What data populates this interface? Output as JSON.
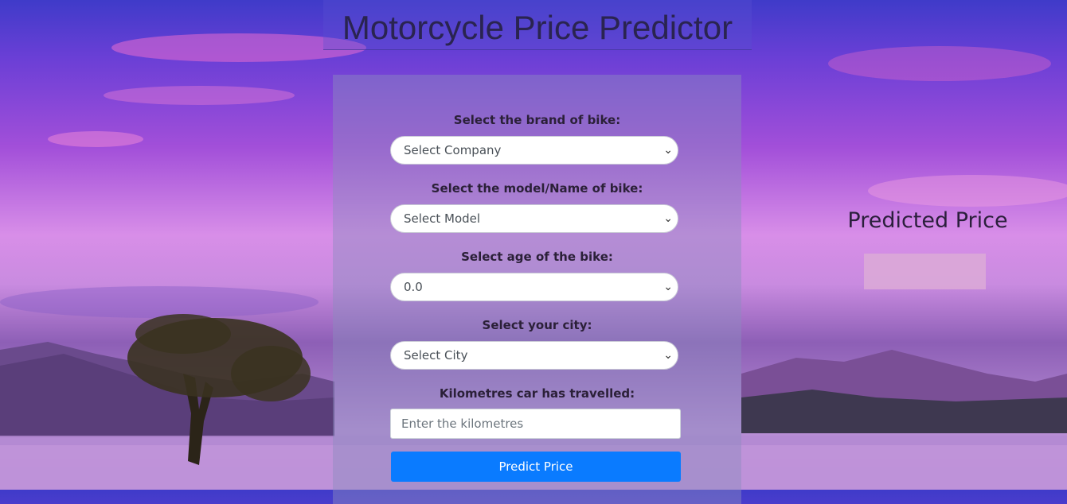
{
  "page": {
    "title": "Motorcycle Price Predictor"
  },
  "form": {
    "brand": {
      "label": "Select the brand of bike:",
      "value": "Select Company"
    },
    "model": {
      "label": "Select the model/Name of bike:",
      "value": "Select Model"
    },
    "age": {
      "label": "Select age of the bike:",
      "value": "0.0"
    },
    "city": {
      "label": "Select your city:",
      "value": "Select City"
    },
    "kms": {
      "label": "Kilometres car has travelled:",
      "placeholder": "Enter the kilometres"
    },
    "submit_label": "Predict Price"
  },
  "result": {
    "heading": "Predicted Price",
    "value": ""
  },
  "icons": {
    "dropdown": "chevron-down-icon"
  },
  "colors": {
    "button": "#0a7bff"
  }
}
